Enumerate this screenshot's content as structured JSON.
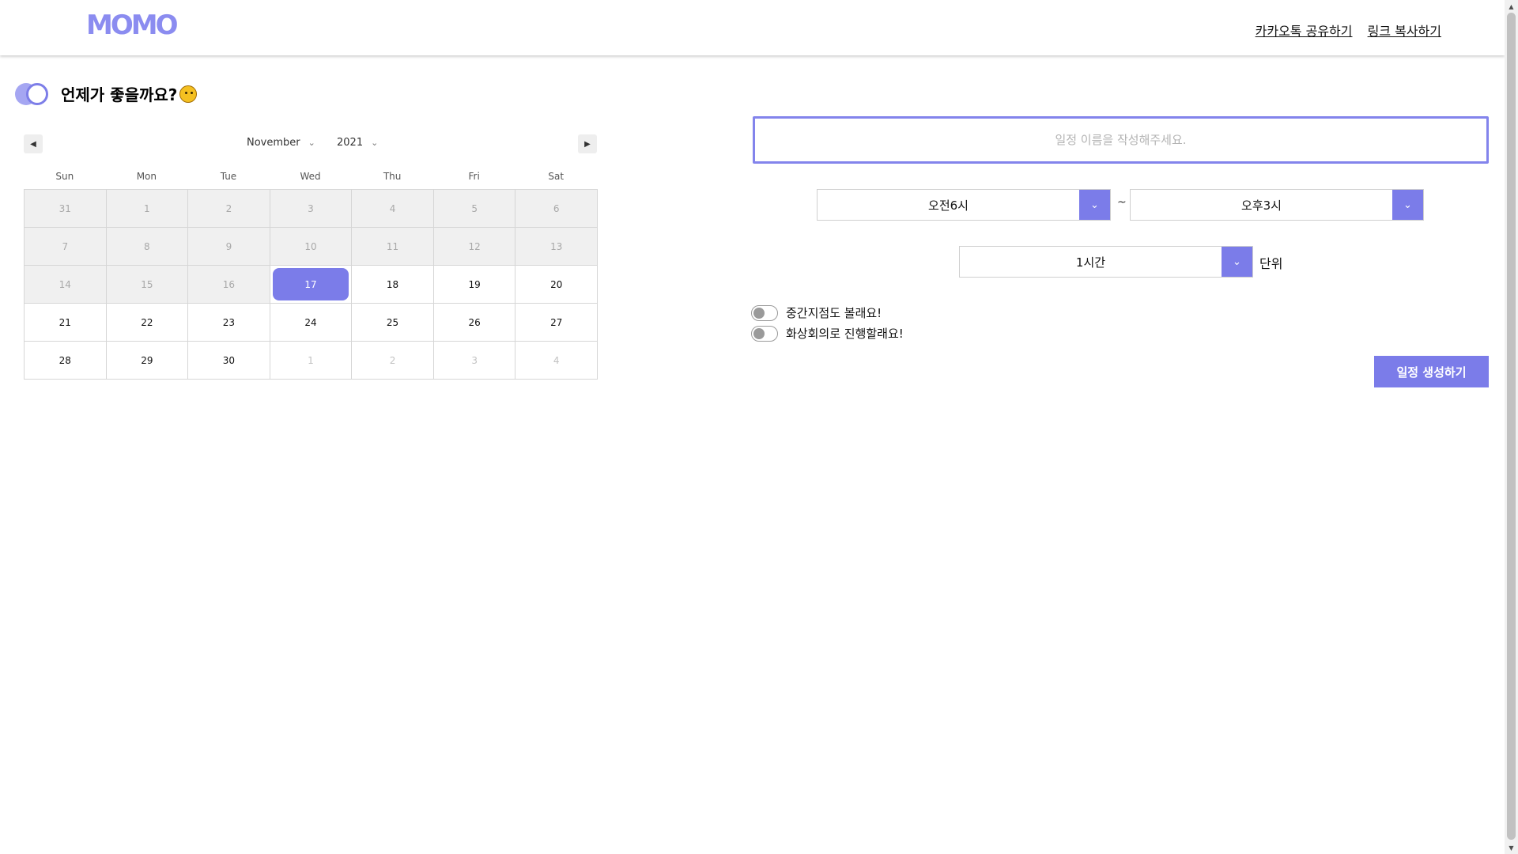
{
  "header": {
    "logo": "MOMO",
    "links": [
      "카카오톡 공유하기",
      "링크 복사하기"
    ]
  },
  "title": "언제가 좋을까요?",
  "calendar": {
    "month": "November",
    "year": "2021",
    "weekdays": [
      "Sun",
      "Mon",
      "Tue",
      "Wed",
      "Thu",
      "Fri",
      "Sat"
    ],
    "weeks": [
      [
        "31",
        "1",
        "2",
        "3",
        "4",
        "5",
        "6"
      ],
      [
        "7",
        "8",
        "9",
        "10",
        "11",
        "12",
        "13"
      ],
      [
        "14",
        "15",
        "16",
        "17",
        "18",
        "19",
        "20"
      ],
      [
        "21",
        "22",
        "23",
        "24",
        "25",
        "26",
        "27"
      ],
      [
        "28",
        "29",
        "30",
        "1",
        "2",
        "3",
        "4"
      ]
    ],
    "selected": "17"
  },
  "form": {
    "name_placeholder": "일정 이름을 작성해주세요.",
    "start_time": "오전6시",
    "separator": "~",
    "end_time": "오후3시",
    "interval": "1시간",
    "unit_label": "단위",
    "toggle_midpoint": "중간지점도 볼래요!",
    "toggle_video": "화상회의로 진행할래요!",
    "create_button": "일정 생성하기"
  },
  "colors": {
    "accent": "#7b7ce9",
    "input_border": "#8384ec",
    "past_cell": "#f0f0f0"
  }
}
